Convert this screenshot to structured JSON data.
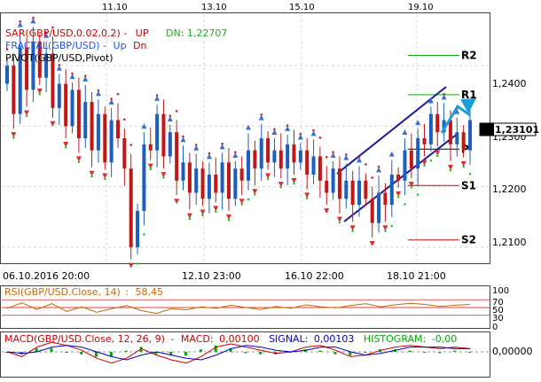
{
  "chart_data": {
    "type": "candlestick",
    "instrument": "GBP/USD",
    "top_date_labels": [
      "11.10",
      "13.10",
      "15.10",
      "19.10"
    ],
    "bottom_date_labels": [
      "06.10.2016 20:00",
      "12.10 23:00",
      "16.10 22:00",
      "18.10 21:00"
    ],
    "y_ticks": [
      "1,2400",
      "1,2300",
      "1,2200",
      "1,2100"
    ],
    "ylim": [
      1.2075,
      1.2485
    ],
    "current_price": "1,23101",
    "current_price_value": 1.23101,
    "pivot_levels": [
      {
        "name": "R2",
        "value": 1.2417,
        "color": "#11aa11"
      },
      {
        "name": "R1",
        "value": 1.2352,
        "color": "#11aa11"
      },
      {
        "name": "P",
        "value": 1.2262,
        "color": "#000000"
      },
      {
        "name": "S1",
        "value": 1.2202,
        "color": "#bb1111"
      },
      {
        "name": "S2",
        "value": 1.2112,
        "color": "#bb1111"
      }
    ],
    "legend": {
      "sar": {
        "name": "SAR(GBP/USD,0.02,0.2) -",
        "state": "UP",
        "color": "#cc0000"
      },
      "fractal": {
        "name": "FRACTAL(GBP/USD) -",
        "up": "Up",
        "dn": "Dn",
        "dn_value": "DN: 1,22707",
        "color": "#2255ee"
      },
      "pivot": {
        "name": "PIVOT(GBP/USD,Pivot)"
      }
    },
    "prices": [
      1.24,
      1.232,
      1.243,
      1.236,
      1.244,
      1.238,
      1.242,
      1.233,
      1.237,
      1.23,
      1.236,
      1.228,
      1.234,
      1.226,
      1.232,
      1.224,
      1.231,
      1.228,
      1.223,
      1.21,
      1.216,
      1.227,
      1.226,
      1.232,
      1.225,
      1.229,
      1.221,
      1.224,
      1.219,
      1.223,
      1.218,
      1.222,
      1.219,
      1.224,
      1.218,
      1.223,
      1.221,
      1.226,
      1.223,
      1.228,
      1.224,
      1.226,
      1.223,
      1.227,
      1.224,
      1.226,
      1.222,
      1.225,
      1.221,
      1.219,
      1.223,
      1.218,
      1.221,
      1.217,
      1.221,
      1.218,
      1.214,
      1.219,
      1.217,
      1.222,
      1.221,
      1.226,
      1.223,
      1.228,
      1.227,
      1.232,
      1.229,
      1.231,
      1.227,
      1.229,
      1.226,
      1.231
    ],
    "rsi": {
      "label": "RSI(GBP/USD.Close, 14)",
      "value": "58,45",
      "color": "#cc6600",
      "ticks": [
        "100",
        "70",
        "50",
        "30",
        "0"
      ],
      "values": [
        48,
        62,
        45,
        60,
        40,
        52,
        38,
        47,
        55,
        42,
        35,
        47,
        44,
        52,
        48,
        56,
        50,
        45,
        53,
        48,
        57,
        52,
        49,
        55,
        60,
        52,
        57,
        61,
        58,
        53,
        56,
        58
      ]
    },
    "macd": {
      "label": "MACD(GBP/USD.Close, 12, 26, 9)",
      "macd_label": "MACD:",
      "macd_value": "0,00100",
      "signal_label": "SIGNAL:",
      "signal_value": "0,00103",
      "hist_label": "HISTOGRAM:",
      "hist_value": "-0,00",
      "macd_color": "#cc0000",
      "signal_color": "#0000cc",
      "hist_color": "#00aa00",
      "y_tick": "0,00000",
      "macd_values": [
        0.0,
        -0.3,
        0.3,
        0.6,
        0.4,
        0.1,
        -0.4,
        -0.7,
        -0.4,
        0.2,
        -0.2,
        -0.5,
        -0.7,
        -0.3,
        0.3,
        0.5,
        0.3,
        0.1,
        -0.1,
        0.0,
        0.3,
        0.4,
        0.1,
        -0.3,
        -0.2,
        0.1,
        0.3,
        0.4,
        0.3,
        0.2,
        0.3,
        0.2
      ],
      "signal_values": [
        0.0,
        -0.1,
        0.0,
        0.3,
        0.4,
        0.3,
        0.0,
        -0.3,
        -0.5,
        -0.2,
        0.0,
        -0.2,
        -0.4,
        -0.5,
        -0.2,
        0.2,
        0.4,
        0.3,
        0.1,
        0.0,
        0.1,
        0.3,
        0.3,
        0.0,
        -0.2,
        -0.1,
        0.1,
        0.3,
        0.3,
        0.3,
        0.2,
        0.2
      ]
    }
  }
}
